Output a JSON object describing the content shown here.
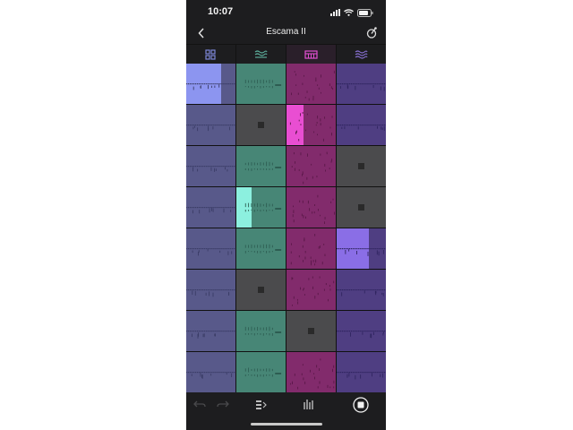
{
  "status": {
    "time": "10:07"
  },
  "header": {
    "title": "Escama II"
  },
  "tabs": [
    {
      "name": "grid",
      "icon": "grid-icon",
      "color": "#7d86d6",
      "active": false
    },
    {
      "name": "wave",
      "icon": "wave-icon",
      "color": "#5fb3a0",
      "active": false
    },
    {
      "name": "synth",
      "icon": "keyboard-icon",
      "color": "#e04fd0",
      "active": true
    },
    {
      "name": "lines",
      "icon": "lines-icon",
      "color": "#8a72d6",
      "active": false
    }
  ],
  "columns": [
    {
      "color": "#58598a",
      "wave": "#3a3c66",
      "active": "#8c95f0"
    },
    {
      "color": "#478676",
      "wave": "#2d5d52",
      "active": "#8cf0df"
    },
    {
      "color": "#822b6c",
      "wave": "#5a1848",
      "active": "#e94ed2"
    },
    {
      "color": "#4f3e82",
      "wave": "#302560",
      "active": "#8a6ee6"
    }
  ],
  "grid": [
    [
      "playing",
      "clip",
      "clip",
      "clip"
    ],
    [
      "clip",
      "stopped",
      "playing",
      "clip"
    ],
    [
      "clip",
      "clip",
      "clip",
      "stopped"
    ],
    [
      "clip",
      "playing",
      "clip",
      "stopped"
    ],
    [
      "clip",
      "clip",
      "clip",
      "playing"
    ],
    [
      "clip",
      "stopped",
      "clip",
      "clip"
    ],
    [
      "clip",
      "clip",
      "stopped",
      "clip"
    ],
    [
      "clip",
      "clip",
      "clip",
      "clip"
    ]
  ],
  "playing_progress": [
    [
      0,
      0.7
    ],
    [
      1,
      0.35
    ],
    [
      3,
      0.3
    ],
    [
      4,
      0.65
    ]
  ],
  "toolbar": [
    "undo-icon",
    "redo-icon",
    "clip-arrow-icon",
    "mixer-icon",
    "stop-icon"
  ]
}
